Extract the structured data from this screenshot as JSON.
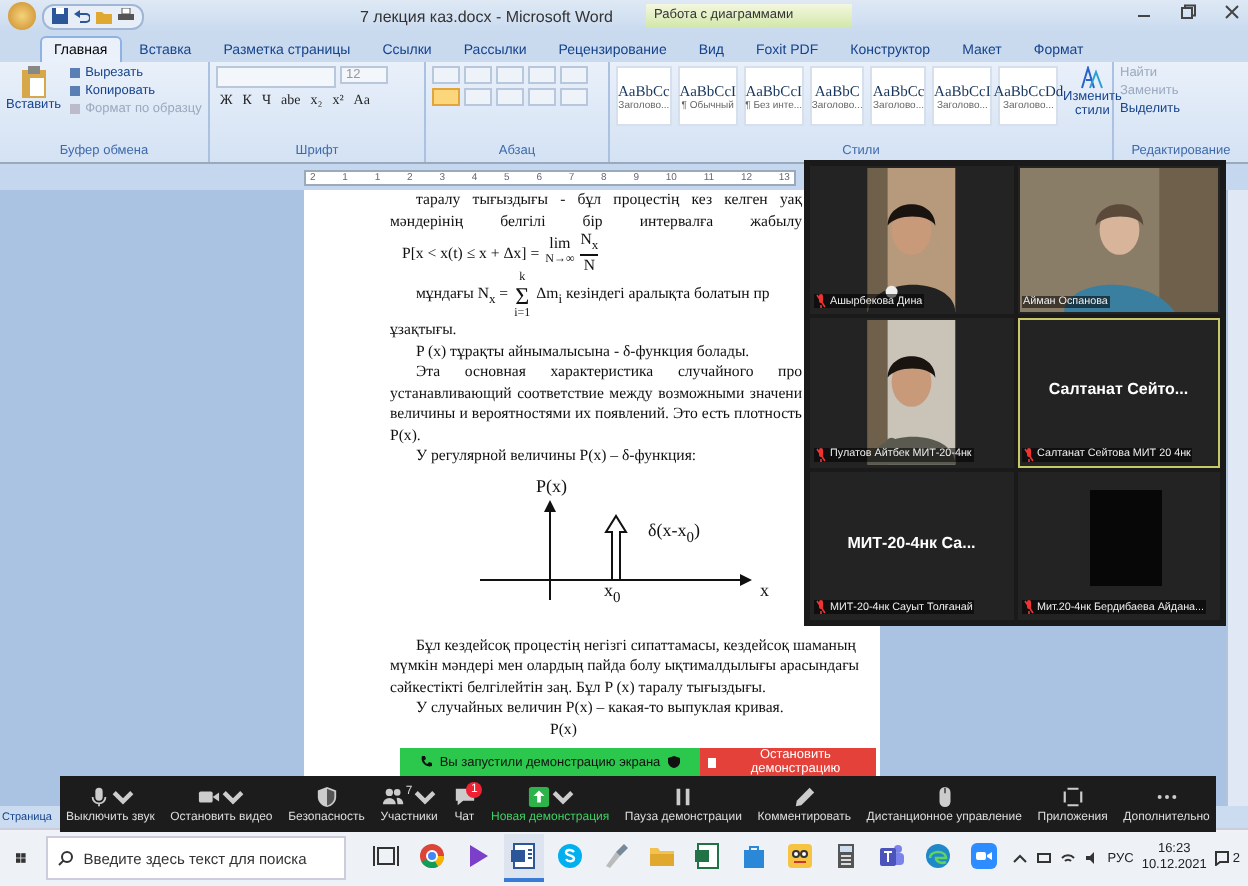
{
  "window": {
    "title": "7 лекция каз.docx - Microsoft Word",
    "context_group": "Работа с диаграммами"
  },
  "tabs": [
    {
      "label": "Главная",
      "selected": true
    },
    {
      "label": "Вставка",
      "selected": false
    },
    {
      "label": "Разметка страницы",
      "selected": false
    },
    {
      "label": "Ссылки",
      "selected": false
    },
    {
      "label": "Рассылки",
      "selected": false
    },
    {
      "label": "Рецензирование",
      "selected": false
    },
    {
      "label": "Вид",
      "selected": false
    },
    {
      "label": "Foxit PDF",
      "selected": false
    },
    {
      "label": "Конструктор",
      "selected": false
    },
    {
      "label": "Макет",
      "selected": false
    },
    {
      "label": "Формат",
      "selected": false
    }
  ],
  "ribbon": {
    "clipboard": {
      "paste": "Вставить",
      "items": [
        {
          "label": "Вырезать",
          "disabled": false
        },
        {
          "label": "Копировать",
          "disabled": false
        },
        {
          "label": "Формат по образцу",
          "disabled": true
        }
      ],
      "label": "Буфер обмена"
    },
    "font": {
      "size": "12",
      "buttons": [
        "Ж",
        "К",
        "Ч",
        "abe",
        "x₂",
        "x²",
        "Aa"
      ],
      "label": "Шрифт"
    },
    "paragraph": {
      "label": "Абзац"
    },
    "styles": {
      "items": [
        {
          "preview": "AaBbCc",
          "name": "Заголово..."
        },
        {
          "preview": "AaBbCcI",
          "name": "¶ Обычный"
        },
        {
          "preview": "AaBbCcI",
          "name": "¶ Без инте..."
        },
        {
          "preview": "AaBbC",
          "name": "Заголово..."
        },
        {
          "preview": "AaBbCc",
          "name": "Заголово..."
        },
        {
          "preview": "AaBbCcI",
          "name": "Заголово..."
        },
        {
          "preview": "AaBbCcDd",
          "name": "Заголово..."
        }
      ],
      "change": "Изменить стили",
      "label": "Стили"
    },
    "editing": {
      "items": [
        {
          "label": "Найти",
          "disabled": true
        },
        {
          "label": "Заменить",
          "disabled": true
        },
        {
          "label": "Выделить",
          "disabled": false
        }
      ],
      "label": "Редактирование"
    }
  },
  "ruler": {
    "marks": [
      "2",
      "1",
      "1",
      "2",
      "3",
      "4",
      "5",
      "6",
      "7",
      "8",
      "9",
      "10",
      "11",
      "12",
      "13"
    ]
  },
  "document": {
    "blocks": [
      {
        "kind": "justify-indent",
        "text": "таралу тығыздығы - бұл процестің кез келген уақ"
      },
      {
        "kind": "justify",
        "text": "мәндерінің белгілі бір интервалға жабылу"
      },
      {
        "kind": "limit",
        "lhs": "P[x < x(t) ≤ x + Δx] =",
        "op": "lim",
        "op_sub": "N→∞",
        "numerator": "N$_{x}$",
        "denominator": "N"
      },
      {
        "kind": "sum",
        "before": "мұндағы N$_{x}$ =",
        "sigma": "Σ",
        "top": "k",
        "bottom": "i=1",
        "after": "Δm$_{i}$ кезіндегі аралықта болатын пр"
      },
      {
        "kind": "left",
        "text": "ұзақтығы."
      },
      {
        "kind": "left-indent",
        "text": "P (x) тұрақты айнымалысына - δ-функция болады."
      },
      {
        "kind": "justify-indent",
        "text": "Эта основная характеристика случайного про"
      },
      {
        "kind": "justify",
        "text": "устанавливающий соответствие между возможными значени"
      },
      {
        "kind": "justify",
        "text": "величины и вероятностями их появлений. Это есть плотность"
      },
      {
        "kind": "left",
        "text": "P(x)."
      },
      {
        "kind": "left-indent",
        "text": "У регулярной величины P(x) – δ-функция:"
      },
      {
        "kind": "diagram",
        "y_label": "P(x)",
        "spike_label": "δ(x-x$_{0}$)",
        "x0_label": "x$_{0}$",
        "x_label": "x"
      },
      {
        "kind": "justify-indent",
        "text": "Бұл кездейсоқ процестің негізгі сипаттамасы, кездейсоқ шаманың"
      },
      {
        "kind": "justify",
        "text": "мүмкін мәндері мен олардың пайда болу ықтималдылығы арасындағы"
      },
      {
        "kind": "left",
        "text": "сәйкестікті белгілейтін заң. Бұл P (x) таралу тығыздығы."
      },
      {
        "kind": "left-indent",
        "text": "У случайных величин P(x) – какая-то выпуклая кривая."
      },
      {
        "kind": "left-center",
        "text": "P(x)"
      }
    ]
  },
  "video_gallery": {
    "tiles": [
      {
        "kind": "video",
        "caption": "Ашырбекова Дина",
        "muted": true,
        "selected": false
      },
      {
        "kind": "video",
        "caption": "Айман Оспанова",
        "muted": false,
        "selected": false
      },
      {
        "kind": "video",
        "caption": "Пулатов Айтбек МИТ-20-4нк",
        "muted": true,
        "selected": false
      },
      {
        "kind": "name",
        "name": "Салтанат Сейто...",
        "caption": "Салтанат Сейтова МИТ 20 4нк",
        "muted": true,
        "selected": true
      },
      {
        "kind": "name",
        "name": "МИТ-20-4нк Са...",
        "caption": "МИТ-20-4нк Сауыт Толғанай",
        "muted": true,
        "selected": false
      },
      {
        "kind": "dark",
        "caption": "Мит.20-4нк Бердибаева Айдана...",
        "muted": true,
        "selected": false
      }
    ]
  },
  "share_banner": {
    "status": "Вы запустили демонстрацию экрана",
    "stop": "Остановить демонстрацию"
  },
  "meeting_toolbar": {
    "items": [
      {
        "kind": "mic",
        "label": "Выключить звук",
        "caret": true
      },
      {
        "kind": "camera",
        "label": "Остановить видео",
        "caret": true
      },
      {
        "kind": "shield",
        "label": "Безопасность",
        "caret": false
      },
      {
        "kind": "people",
        "label": "Участники",
        "count": "7",
        "caret": true
      },
      {
        "kind": "chat",
        "label": "Чат",
        "badge": "1",
        "caret": false
      },
      {
        "kind": "share",
        "label": "Новая демонстрация",
        "caret": true
      },
      {
        "kind": "pause",
        "label": "Пауза демонстрации",
        "caret": false
      },
      {
        "kind": "pen",
        "label": "Комментировать",
        "caret": false
      },
      {
        "kind": "mouse",
        "label": "Дистанционное управление",
        "caret": false
      },
      {
        "kind": "apps",
        "label": "Приложения",
        "caret": false
      },
      {
        "kind": "more",
        "label": "Дополнительно",
        "caret": false
      }
    ]
  },
  "status_bar": {
    "page": "Страница"
  },
  "taskbar": {
    "search": {
      "placeholder": "Введите здесь текст для поиска"
    },
    "apps": [
      {
        "kind": "taskview",
        "selected": false
      },
      {
        "kind": "chrome",
        "selected": false
      },
      {
        "kind": "player",
        "selected": false
      },
      {
        "kind": "word",
        "selected": true
      },
      {
        "kind": "skype",
        "selected": false
      },
      {
        "kind": "paint",
        "selected": false
      },
      {
        "kind": "folder",
        "selected": false
      },
      {
        "kind": "sheet",
        "selected": false
      },
      {
        "kind": "store",
        "selected": false
      },
      {
        "kind": "game",
        "selected": false
      },
      {
        "kind": "calculator",
        "selected": false
      },
      {
        "kind": "teams",
        "selected": false
      },
      {
        "kind": "edge",
        "selected": false
      },
      {
        "kind": "zoom",
        "selected": false
      }
    ],
    "language": "РУС",
    "time": "16:23",
    "date": "10.12.2021",
    "notifications": "2"
  }
}
